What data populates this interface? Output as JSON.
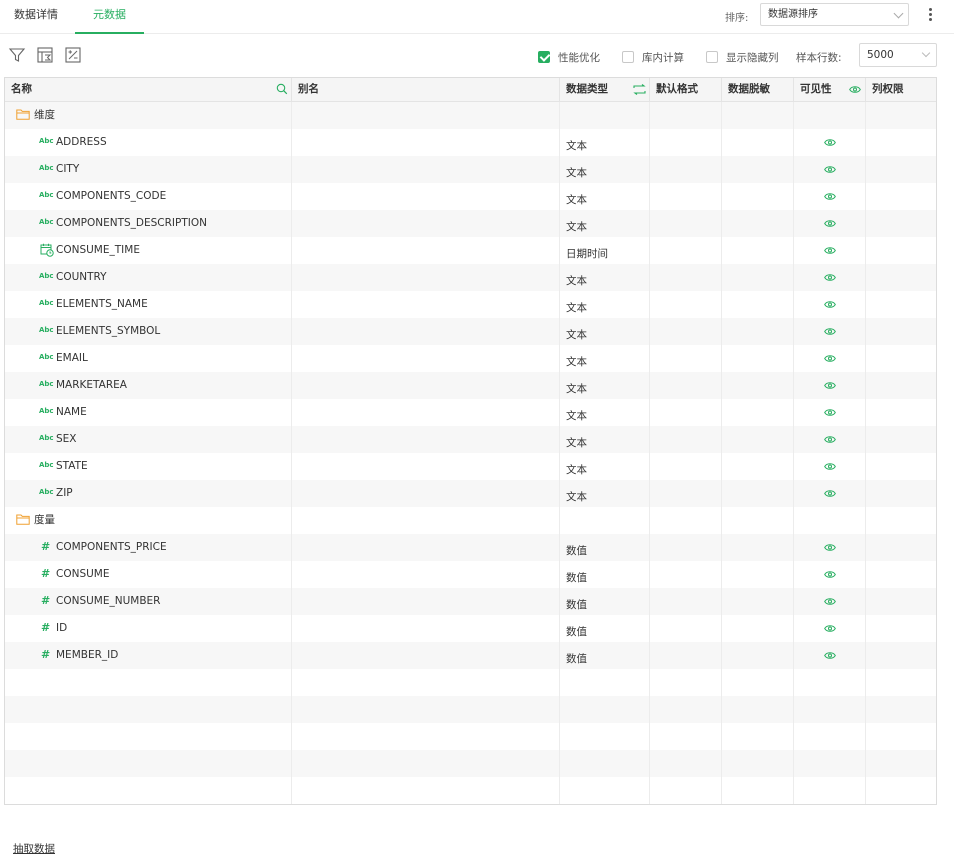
{
  "tabs": [
    {
      "label": "数据详情",
      "active": false
    },
    {
      "label": "元数据",
      "active": true
    }
  ],
  "sort": {
    "label": "排序:",
    "value": "数据源排序"
  },
  "toolbar": {
    "icons": [
      "filter-icon",
      "calculated-field-icon",
      "parameter-icon"
    ],
    "checkboxes": [
      {
        "label": "性能优化",
        "checked": true
      },
      {
        "label": "库内计算",
        "checked": false
      },
      {
        "label": "显示隐藏列",
        "checked": false
      }
    ],
    "sample_rows_label": "样本行数:",
    "sample_rows_value": "5000"
  },
  "columns": [
    "名称",
    "别名",
    "数据类型",
    "默认格式",
    "数据脱敏",
    "可见性",
    "列权限"
  ],
  "groups": [
    {
      "name": "维度",
      "fields": [
        {
          "name": "ADDRESS",
          "type": "文本",
          "icon": "abc"
        },
        {
          "name": "CITY",
          "type": "文本",
          "icon": "abc"
        },
        {
          "name": "COMPONENTS_CODE",
          "type": "文本",
          "icon": "abc"
        },
        {
          "name": "COMPONENTS_DESCRIPTION",
          "type": "文本",
          "icon": "abc"
        },
        {
          "name": "CONSUME_TIME",
          "type": "日期时间",
          "icon": "datetime"
        },
        {
          "name": "COUNTRY",
          "type": "文本",
          "icon": "abc"
        },
        {
          "name": "ELEMENTS_NAME",
          "type": "文本",
          "icon": "abc"
        },
        {
          "name": "ELEMENTS_SYMBOL",
          "type": "文本",
          "icon": "abc"
        },
        {
          "name": "EMAIL",
          "type": "文本",
          "icon": "abc"
        },
        {
          "name": "MARKETAREA",
          "type": "文本",
          "icon": "abc"
        },
        {
          "name": "NAME",
          "type": "文本",
          "icon": "abc"
        },
        {
          "name": "SEX",
          "type": "文本",
          "icon": "abc"
        },
        {
          "name": "STATE",
          "type": "文本",
          "icon": "abc"
        },
        {
          "name": "ZIP",
          "type": "文本",
          "icon": "abc"
        }
      ]
    },
    {
      "name": "度量",
      "fields": [
        {
          "name": "COMPONENTS_PRICE",
          "type": "数值",
          "icon": "number"
        },
        {
          "name": "CONSUME",
          "type": "数值",
          "icon": "number"
        },
        {
          "name": "CONSUME_NUMBER",
          "type": "数值",
          "icon": "number"
        },
        {
          "name": "ID",
          "type": "数值",
          "icon": "number"
        },
        {
          "name": "MEMBER_ID",
          "type": "数值",
          "icon": "number"
        }
      ]
    }
  ],
  "abc_glyph": "Abc",
  "hash_glyph": "#",
  "extract_link": "抽取数据",
  "colors": {
    "accent": "#27ae60",
    "folder": "#f0a030"
  }
}
